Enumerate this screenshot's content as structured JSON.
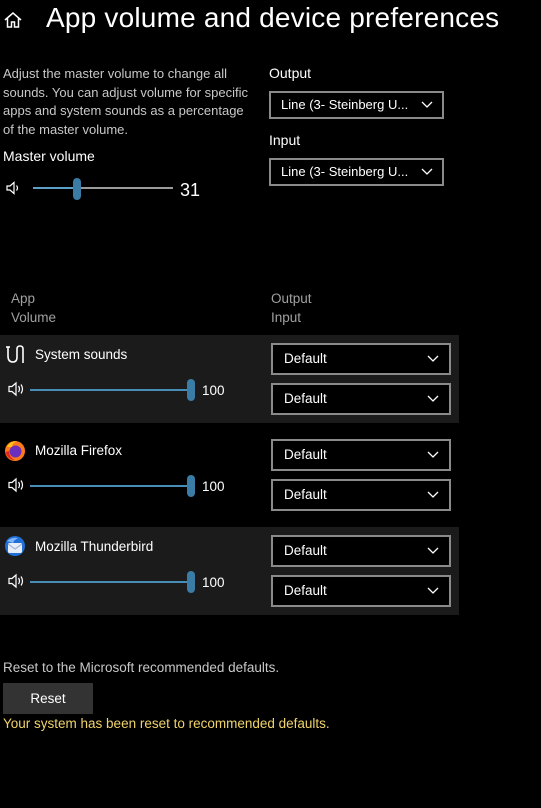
{
  "page": {
    "title": "App volume and device preferences",
    "description": "Adjust the master volume to change all sounds. You can adjust volume for specific apps and system sounds as a percentage of the master volume."
  },
  "master": {
    "label": "Master volume",
    "value": "31",
    "level": 0.31
  },
  "devices": {
    "output_label": "Output",
    "output_value": "Line (3- Steinberg U...",
    "input_label": "Input",
    "input_value": "Line (3- Steinberg U..."
  },
  "columns": {
    "app": "App",
    "volume": "Volume",
    "output": "Output",
    "input": "Input"
  },
  "apps": [
    {
      "name": "System sounds",
      "volume": "100",
      "level": 1.0,
      "output": "Default",
      "input": "Default",
      "icon": "system-sounds-icon"
    },
    {
      "name": "Mozilla Firefox",
      "volume": "100",
      "level": 1.0,
      "output": "Default",
      "input": "Default",
      "icon": "firefox-icon"
    },
    {
      "name": "Mozilla Thunderbird",
      "volume": "100",
      "level": 1.0,
      "output": "Default",
      "input": "Default",
      "icon": "thunderbird-icon"
    }
  ],
  "reset": {
    "description": "Reset to the Microsoft recommended defaults.",
    "button_label": "Reset",
    "status": "Your system has been reset to recommended defaults."
  },
  "colors": {
    "background": "#000000",
    "accent": "#3a7ca5",
    "status": "#f0d36b"
  }
}
